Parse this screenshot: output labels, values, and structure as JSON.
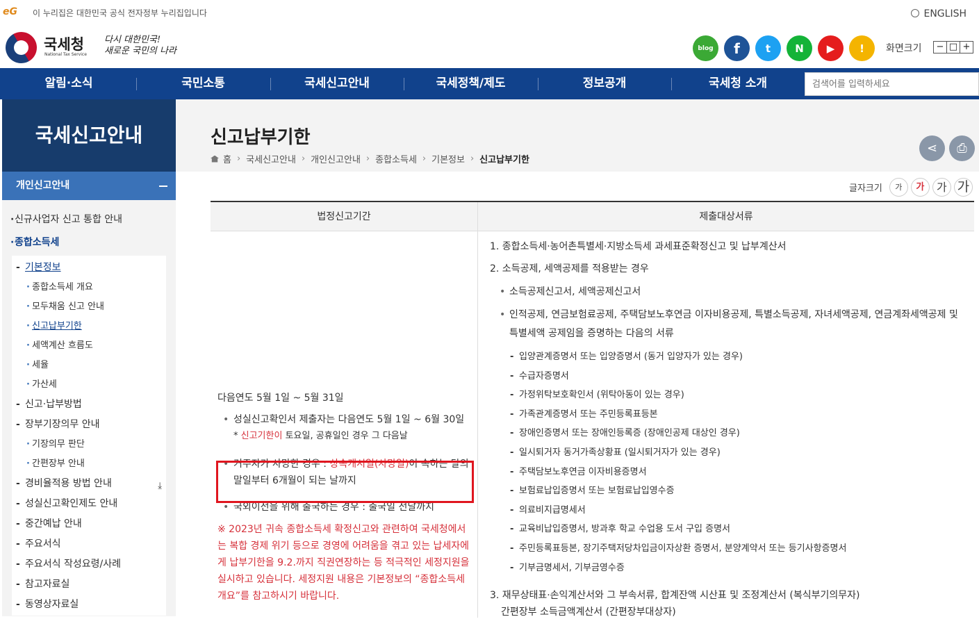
{
  "top_bar": {
    "gov_logo": "eG",
    "gov_text": "이 누리집은 대한민국 공식 전자정부 누리집입니다",
    "english": "ENGLISH"
  },
  "header": {
    "logo_ko": "국세청",
    "logo_en": "National Tax Service",
    "slogan_line1": "다시 대한민국!",
    "slogan_line2": "새로운 국민의 나라",
    "sns": [
      "blog",
      "f",
      "t",
      "N",
      "▶",
      "!"
    ],
    "zoom_label": "화면크기",
    "zoom_minus": "−",
    "zoom_reset": "□",
    "zoom_plus": "+"
  },
  "gnb": {
    "items": [
      "알림·소식",
      "국민소통",
      "국세신고안내",
      "국세정책/제도",
      "정보공개",
      "국세청 소개"
    ],
    "search_placeholder": "검색어를 입력하세요"
  },
  "lnb": {
    "title": "국세신고안내",
    "category": "개인신고안내",
    "items": {
      "new_biz": "신규사업자 신고 통합 안내",
      "income_tax": "종합소득세",
      "basic_info": "기본정보",
      "overview": "종합소득세 개요",
      "batch": "모두채움 신고 안내",
      "deadline": "신고납부기한",
      "flow": "세액계산 흐름도",
      "rates": "세율",
      "penalty": "가산세",
      "filing": "신고·납부방법",
      "bookkeeping": "장부기장의무 안내",
      "bk_judge": "기장의무 판단",
      "simple_book": "간편장부 안내",
      "expense": "경비율적용 방법 안내",
      "sincere": "성실신고확인제도 안내",
      "interim": "중간예납 안내",
      "forms": "주요서식",
      "forms_guide": "주요서식 작성요령/사례",
      "references": "참고자료실",
      "videos": "동영상자료실"
    }
  },
  "content": {
    "page_title": "신고납부기한",
    "breadcrumb": [
      "홈",
      "국세신고안내",
      "개인신고안내",
      "종합소득세",
      "기본정보",
      "신고납부기한"
    ],
    "font_size_label": "글자크기",
    "font_size_btns": [
      "가",
      "가",
      "가",
      "가"
    ]
  },
  "table": {
    "headers": [
      "법정신고기간",
      "제출대상서류"
    ],
    "left": {
      "main": "다음연도 5월 1일 ~ 5월 31일",
      "b1": "성실신고확인서 제출자는 다음연도 5월 1일 ~ 6월 30일",
      "note_star": "* ",
      "note_red": "신고기한이",
      "note_rest": " 토요일, 공휴일인 경우 그 다음날",
      "b2_pre": "거주자가 사망한 경우 : ",
      "b2_red": "상속개시일(사망일)",
      "b2_post": "이 속하는 달의 말일부터 6개월이 되는 날까지",
      "b3": "국외이전을 위해 출국하는 경우 : 출국일 전날까지",
      "red_note": "※ 2023년 귀속 종합소득세 확정신고와 관련하여 국세청에서는 복합 경제 위기 등으로 경영에 어려움을 겪고 있는 납세자에게 납부기한을 9.2.까지 직권연장하는 등 적극적인 세정지원을 실시하고 있습니다. 세정지원 내용은 기본정보의 “종합소득세 개요”를 참고하시기 바랍니다."
    },
    "right": {
      "item1": "1. 종합소득세·농어촌특별세·지방소득세 과세표준확정신고 및 납부계산서",
      "item2": "2. 소득공제, 세액공제를 적용받는 경우",
      "bul1": "소득공제신고서, 세액공제신고서",
      "bul2": "인적공제, 연금보험료공제, 주택담보노후연금 이자비용공제, 특별소득공제, 자녀세액공제, 연금계좌세액공제 및 특별세액 공제임을 증명하는 다음의 서류",
      "dashes": [
        "입양관계증명서 또는 입양증명서 (동거 입양자가 있는 경우)",
        "수급자증명서",
        "가정위탁보호확인서 (위탁아동이 있는 경우)",
        "가족관계증명서 또는 주민등록표등본",
        "장애인증명서 또는 장애인등록증 (장애인공제 대상인 경우)",
        "일시퇴거자 동거가족상황표 (일시퇴거자가 있는 경우)",
        "주택담보노후연금 이자비용증명서",
        "보험료납입증명서 또는 보험료납입영수증",
        "의료비지급명세서",
        "교육비납입증명서, 방과후 학교 수업용 도서 구입 증명서",
        "주민등록표등본, 장기주택저당차입금이자상환 증명서, 분양계약서 또는 등기사항증명서",
        "기부금명세서, 기부금영수증"
      ],
      "item3": "3. 재무상태표·손익계산서와 그 부속서류, 합계잔액 시산표 및 조정계산서 (복식부기의무자)",
      "item3b": "간편장부 소득금액계산서 (간편장부대상자)"
    }
  }
}
